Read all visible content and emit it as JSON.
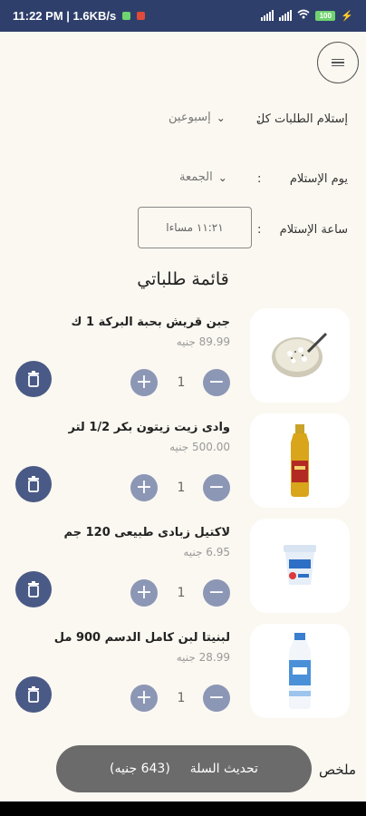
{
  "status": {
    "time_speed": "11:22 PM | 1.6KB/s",
    "battery": "100"
  },
  "settings": {
    "receive_every_label": "إستلام الطلبات كل",
    "receive_every_value": "إسبوعين",
    "receive_day_label": "يوم الإستلام",
    "receive_day_value": "الجمعة",
    "receive_time_label": "ساعة الإستلام",
    "receive_time_value": "١١:٢١ مساءا",
    "colon": ":"
  },
  "list_title": "قائمة طلباتي",
  "items": [
    {
      "name": "جبن قريش بحبة البركة 1 ك",
      "price": "89.99 جنيه",
      "qty": "1",
      "image": "cottage-cheese-bowl"
    },
    {
      "name": "وادى زيت زيتون بكر 1/2 لتر",
      "price": "500.00 جنيه",
      "qty": "1",
      "image": "olive-oil-bottle"
    },
    {
      "name": "لاكتيل زبادى طبيعى 120 جم",
      "price": "6.95 جنيه",
      "qty": "1",
      "image": "yogurt-cup"
    },
    {
      "name": "لبنيتا لبن كامل الدسم 900 مل",
      "price": "28.99 جنيه",
      "qty": "1",
      "image": "milk-bottle"
    }
  ],
  "summary_label": "ملخص",
  "cart": {
    "label": "تحديث السلة",
    "total": "(643 جنيه)"
  },
  "colors": {
    "status_bar": "#2f3f6b",
    "button_light": "#8c97b6",
    "button_dark": "#4a5a86",
    "background": "#fbf8f1"
  }
}
